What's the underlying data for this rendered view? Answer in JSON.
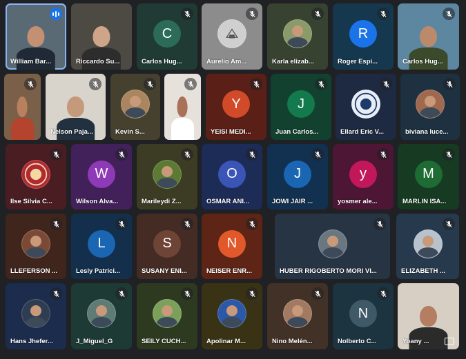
{
  "participants": [
    {
      "name": "William Bar...",
      "initial": "",
      "bg": "#5a6a74",
      "type": "camera",
      "state": "speaking",
      "skin": "#c39073",
      "shirt": "#1f2a36"
    },
    {
      "name": "Riccardo Su...",
      "initial": "",
      "bg": "#4d4a44",
      "type": "camera",
      "state": "none",
      "skin": "#cfa58a",
      "shirt": "#2d2d2d"
    },
    {
      "name": "Carlos Hug...",
      "initial": "C",
      "bg": "#1f3b33",
      "avatar": "#2d6b59",
      "type": "letter",
      "state": "muted"
    },
    {
      "name": "Aurelio Am...",
      "initial": "",
      "bg": "#8c8c8c",
      "avatar": "#cfcfcf",
      "type": "logo",
      "state": "muted"
    },
    {
      "name": "Karla elizab...",
      "initial": "",
      "bg": "#384231",
      "avatar": "#8a9a68",
      "type": "photo",
      "state": "muted"
    },
    {
      "name": "Roger Espi...",
      "initial": "R",
      "bg": "#15384f",
      "avatar": "#1a73e8",
      "type": "letter",
      "state": "muted"
    },
    {
      "name": "Carlos Hug...",
      "initial": "",
      "bg": "#5d86a0",
      "type": "camera",
      "state": "muted",
      "skin": "#bb8a6a",
      "shirt": "#3b4a2a"
    },
    {
      "name": "",
      "initial": "",
      "bg": "#7a6048",
      "type": "camera",
      "state": "muted",
      "skin": "#b8805e",
      "shirt": "#b5442e"
    },
    {
      "name": "Nelson Paja...",
      "initial": "",
      "bg": "#d8d4cc",
      "type": "camera",
      "state": "muted",
      "skin": "#c59a7c",
      "shirt": "#22313f"
    },
    {
      "name": "Kevin S...",
      "initial": "",
      "bg": "#46412f",
      "avatar": "#a98660",
      "type": "photo",
      "state": "muted"
    },
    {
      "name": "",
      "initial": "",
      "bg": "#e6e1da",
      "type": "camera",
      "state": "muted",
      "skin": "#a97258",
      "shirt": "#ffffff"
    },
    {
      "name": "YEISI MEDI...",
      "initial": "Y",
      "bg": "#5a1f16",
      "avatar": "#d14a2a",
      "type": "letter",
      "state": "muted"
    },
    {
      "name": "Juan Carlos...",
      "initial": "J",
      "bg": "#12422f",
      "avatar": "#137a4e",
      "type": "letter",
      "state": "muted"
    },
    {
      "name": "Ellard Eric V...",
      "initial": "",
      "bg": "#1d2a41",
      "avatar": "#e8ecf4",
      "type": "seal",
      "state": "muted"
    },
    {
      "name": "biviana luce...",
      "initial": "",
      "bg": "#1d3140",
      "avatar": "#a0684e",
      "type": "photo",
      "state": "muted"
    },
    {
      "name": "Ilse Silvia C...",
      "initial": "",
      "bg": "#4a1d22",
      "avatar": "#b02a36",
      "type": "emblem",
      "state": "muted"
    },
    {
      "name": "Wilson Alva...",
      "initial": "W",
      "bg": "#42215a",
      "avatar": "#8e3ab6",
      "type": "letter",
      "state": "muted"
    },
    {
      "name": "Marileydi Z...",
      "initial": "",
      "bg": "#3c3b24",
      "avatar": "#5c7a34",
      "type": "photo",
      "state": "muted"
    },
    {
      "name": "OSMAR ANI...",
      "initial": "O",
      "bg": "#1c2c57",
      "avatar": "#3a55b6",
      "type": "letter",
      "state": "muted"
    },
    {
      "name": "JOWI JAIR ...",
      "initial": "J",
      "bg": "#12304f",
      "avatar": "#1a66b3",
      "type": "letter",
      "state": "muted"
    },
    {
      "name": "yosmer ale...",
      "initial": "y",
      "bg": "#4c1634",
      "avatar": "#c2185b",
      "type": "letter",
      "state": "muted"
    },
    {
      "name": "MARLIN ISA...",
      "initial": "M",
      "bg": "#163a22",
      "avatar": "#1e6b34",
      "type": "letter",
      "state": "muted"
    },
    {
      "name": "LLEFERSON ...",
      "initial": "",
      "bg": "#40251d",
      "avatar": "#7a4a36",
      "type": "photo",
      "state": "muted"
    },
    {
      "name": "Lesly Patrici...",
      "initial": "L",
      "bg": "#132f4b",
      "avatar": "#1a66b3",
      "type": "letter",
      "state": "muted"
    },
    {
      "name": "SUSANY ENI...",
      "initial": "S",
      "bg": "#442c24",
      "avatar": "#6d4436",
      "type": "letter",
      "state": "muted"
    },
    {
      "name": "NEISER ENR...",
      "initial": "N",
      "bg": "#5e2415",
      "avatar": "#e1592a",
      "type": "letter",
      "state": "muted"
    },
    {
      "name": "HUBER RIGOBERTO MORI VI...",
      "initial": "",
      "bg": "#263444",
      "avatar": "#6a7680",
      "type": "photo",
      "state": "muted"
    },
    {
      "name": "ELIZABETH ...",
      "initial": "",
      "bg": "#273a4d",
      "avatar": "#b7c2cc",
      "type": "photo",
      "state": "muted"
    },
    {
      "name": "Hans Jhefer...",
      "initial": "",
      "bg": "#1c2c4d",
      "avatar": "#2e3d52",
      "type": "photo",
      "state": "muted"
    },
    {
      "name": "J_Miguel_G",
      "initial": "",
      "bg": "#1d3a34",
      "avatar": "#5e7c74",
      "type": "photo",
      "state": "muted"
    },
    {
      "name": "SEILY CUCH...",
      "initial": "",
      "bg": "#2e3a1f",
      "avatar": "#7aa05a",
      "type": "photo",
      "state": "muted"
    },
    {
      "name": "Apolinar M...",
      "initial": "",
      "bg": "#3a3214",
      "avatar": "#2c58a8",
      "type": "photo",
      "state": "muted"
    },
    {
      "name": "Nino Melén...",
      "initial": "",
      "bg": "#413126",
      "avatar": "#a27a62",
      "type": "photo",
      "state": "muted"
    },
    {
      "name": "Nolberto C...",
      "initial": "N",
      "bg": "#1c3440",
      "avatar": "#3f5966",
      "type": "letter",
      "state": "muted"
    },
    {
      "name": "Yoany ...",
      "initial": "",
      "bg": "#d7cfc4",
      "type": "camera",
      "state": "presenting",
      "skin": "#b57e62",
      "shirt": "#2b2b2b"
    }
  ]
}
